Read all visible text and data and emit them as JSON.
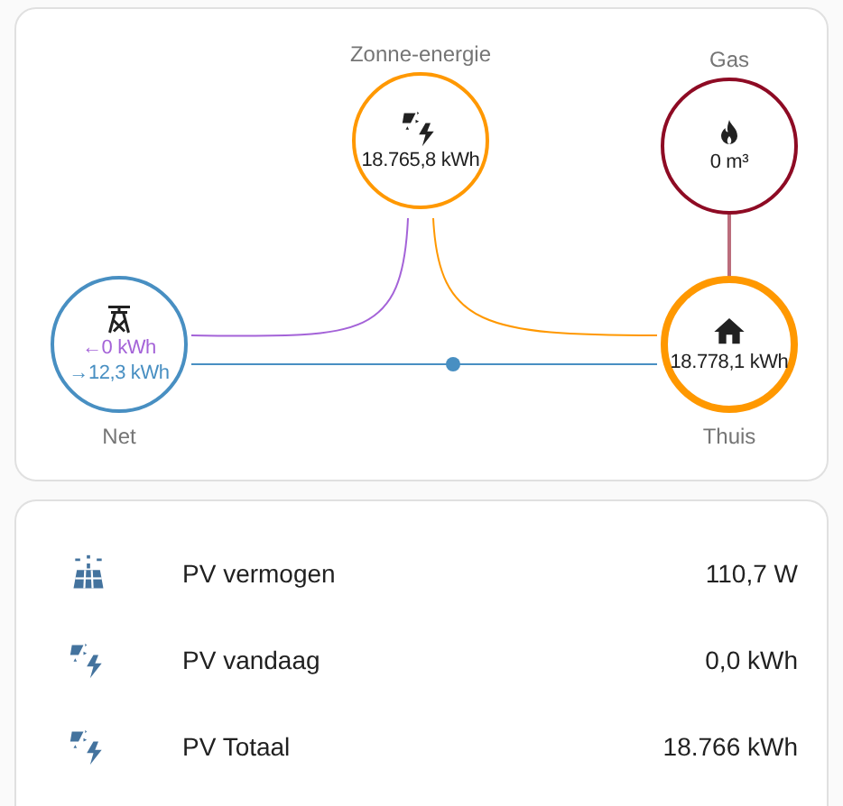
{
  "energy_flow": {
    "nodes": [
      {
        "kind": "solar",
        "label": "Zonne-energie",
        "values": [
          {
            "text": "18.765,8 kWh",
            "color": "#212121"
          }
        ],
        "color": "#ff9800"
      },
      {
        "kind": "gas",
        "label": "Gas",
        "values": [
          {
            "text": "0 m³",
            "color": "#212121"
          }
        ],
        "color": "#8e0b24"
      },
      {
        "kind": "grid",
        "label": "Net",
        "values": [
          {
            "text": "←0 kWh",
            "color": "#a463d8"
          },
          {
            "text": "→12,3 kWh",
            "color": "#488fc2"
          }
        ],
        "color": "#488fc2"
      },
      {
        "kind": "home",
        "label": "Thuis",
        "values": [
          {
            "text": "18.778,1 kWh",
            "color": "#212121"
          }
        ],
        "color": "#ff9800"
      }
    ]
  },
  "entities": [
    {
      "kind": "panel",
      "name": "PV vermogen",
      "state": "110,7 W"
    },
    {
      "kind": "solar",
      "name": "PV vandaag",
      "state": "0,0 kWh"
    },
    {
      "kind": "solar",
      "name": "PV Totaal",
      "state": "18.766 kWh"
    }
  ]
}
